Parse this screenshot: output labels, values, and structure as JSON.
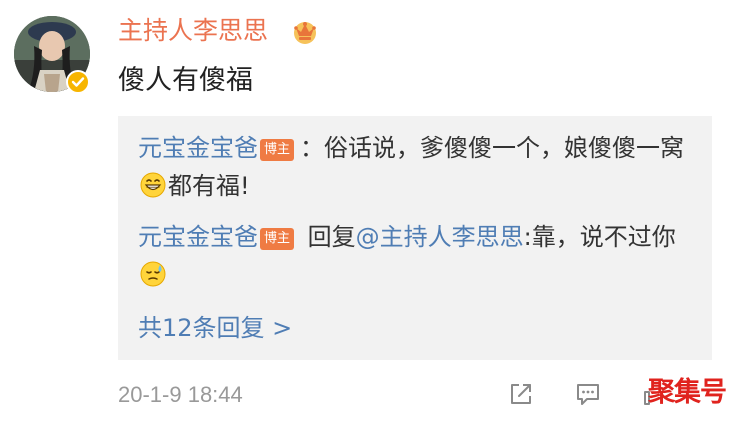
{
  "post": {
    "author": "主持人李思思",
    "text": "傻人有傻福",
    "timestamp": "20-1-9 18:44"
  },
  "comments": [
    {
      "author": "元宝金宝爸",
      "badge": "博主",
      "separator": "：",
      "text_before_emoji": "俗话说，爹傻傻一个，娘傻傻一窝",
      "text_after_emoji": "都有福!",
      "emoji": "grinning-face-icon"
    },
    {
      "author": "元宝金宝爸",
      "badge": "博主",
      "reply_prefix": " 回复",
      "mention": "@主持人李思思",
      "text": ":靠，说不过你",
      "emoji": "sweat-face-icon"
    }
  ],
  "reply_count_label": "共12条回复 >",
  "watermark": "聚集号",
  "colors": {
    "username": "#eb7350",
    "link": "#4f7db4",
    "badge": "#ef7b43",
    "verified": "#f7b500",
    "comment_bg": "#f2f2f2",
    "meta": "#999999",
    "watermark": "#e0231e"
  }
}
